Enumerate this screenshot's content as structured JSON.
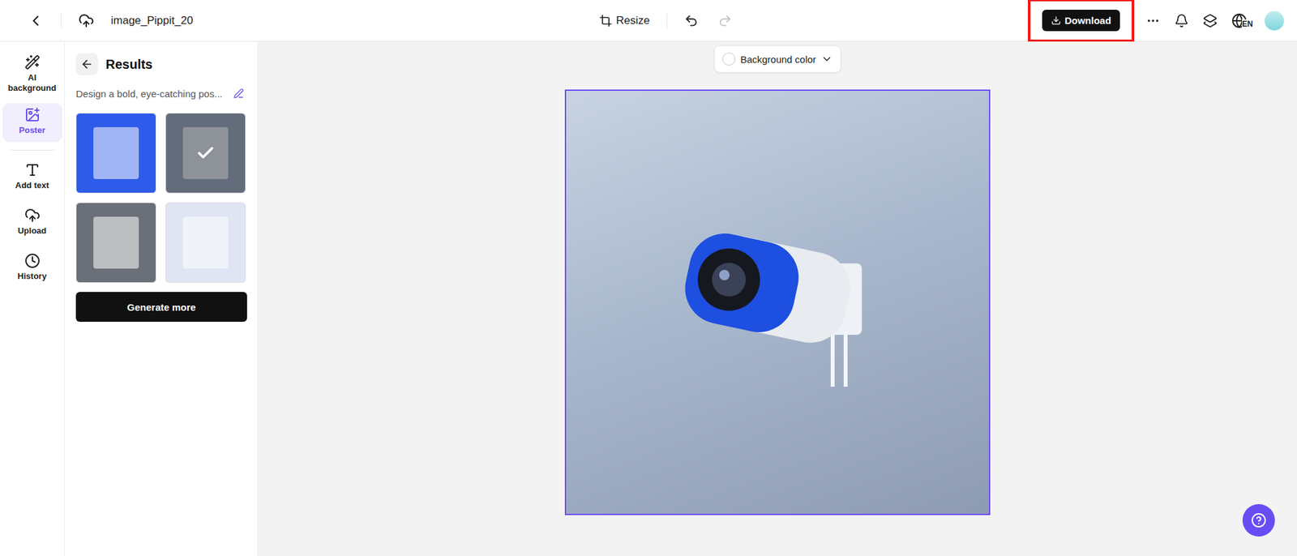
{
  "topbar": {
    "title": "image_Pippit_20",
    "resize": "Resize",
    "download": {
      "label": "Download",
      "highlighted": true
    },
    "language": "EN"
  },
  "rail": [
    {
      "label": "AI background",
      "selected": false
    },
    {
      "label": "Poster",
      "selected": true
    },
    {
      "label": "Add text",
      "selected": false
    },
    {
      "label": "Upload",
      "selected": false
    },
    {
      "label": "History",
      "selected": false
    }
  ],
  "panel": {
    "title": "Results",
    "prompt": "Design a bold, eye-catching pos...",
    "thumbnails": [
      {
        "selected": false,
        "color": "#2f5bea"
      },
      {
        "selected": true,
        "color": "#8f9bb0"
      },
      {
        "selected": false,
        "color": "#6b6f78"
      },
      {
        "selected": false,
        "color": "#dfe5f3"
      }
    ],
    "generate": "Generate more"
  },
  "canvas": {
    "background_button": "Background color"
  }
}
